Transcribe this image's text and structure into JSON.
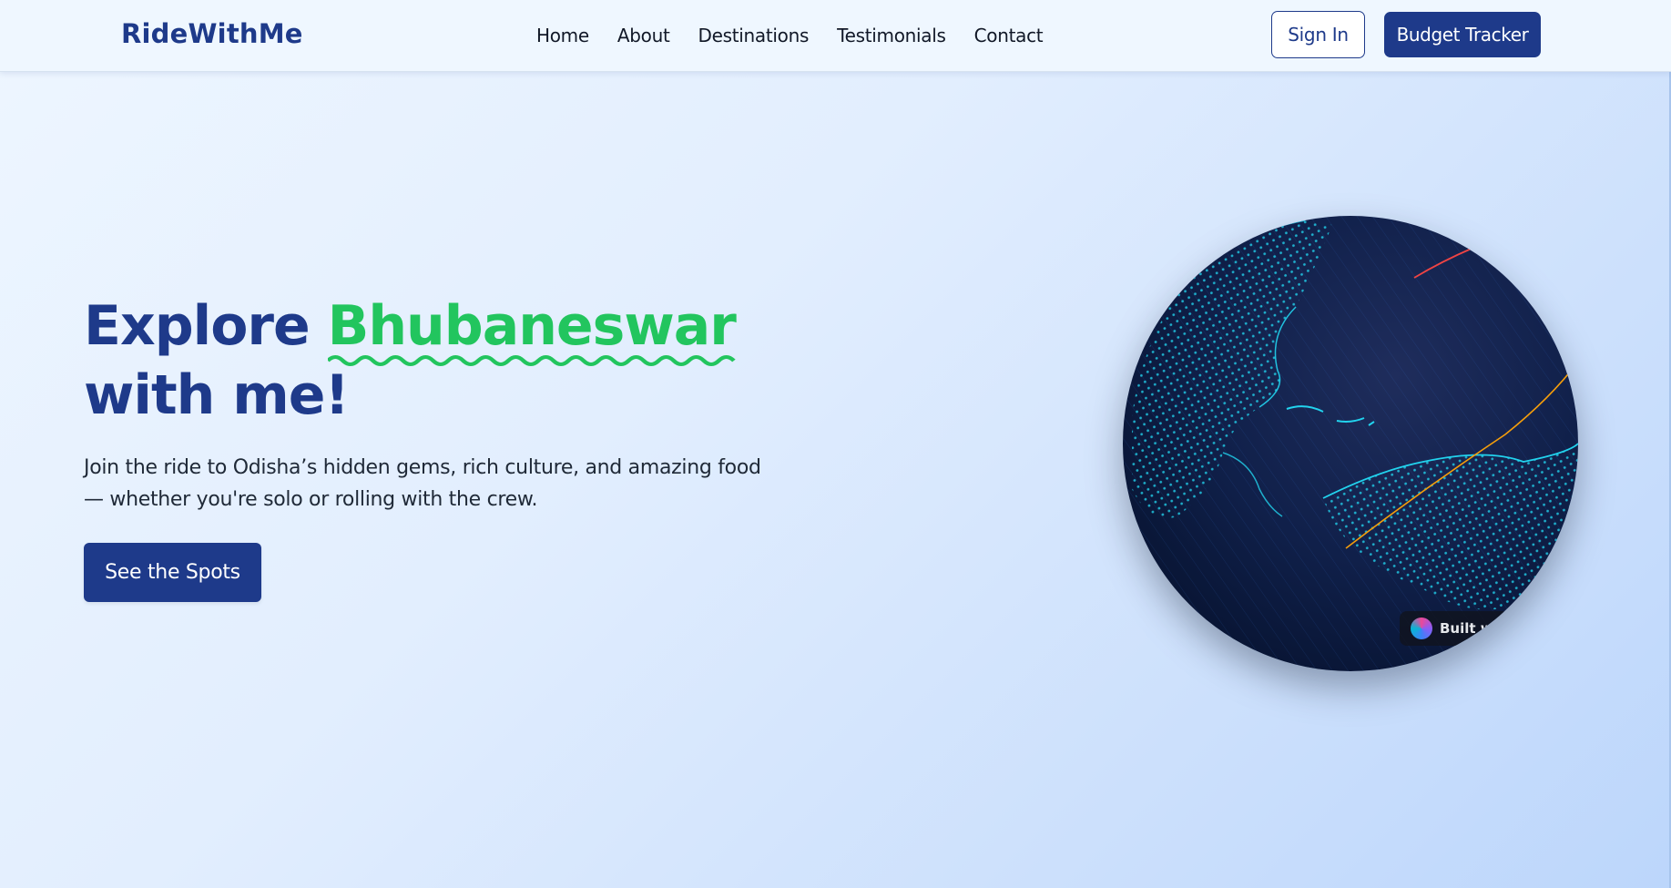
{
  "header": {
    "logo": "RideWithMe",
    "nav": [
      "Home",
      "About",
      "Destinations",
      "Testimonials",
      "Contact"
    ],
    "signin_label": "Sign In",
    "budget_label": "Budget Tracker"
  },
  "hero": {
    "title_pre": "Explore ",
    "title_highlight": "Bhubaneswar",
    "title_post": "with me!",
    "subtitle": "Join the ride to Odisha’s hidden gems, rich culture, and amazing food — whether you're solo or rolling with the crew.",
    "cta_label": "See the Spots"
  },
  "badge": {
    "text": "Built with"
  },
  "colors": {
    "brand": "#1e3a8a",
    "accent": "#22c55e",
    "globe_bg": "#0b1a3a",
    "globe_land": "#22d3ee"
  },
  "icons": [
    "globe-image",
    "badge-logo-icon"
  ]
}
